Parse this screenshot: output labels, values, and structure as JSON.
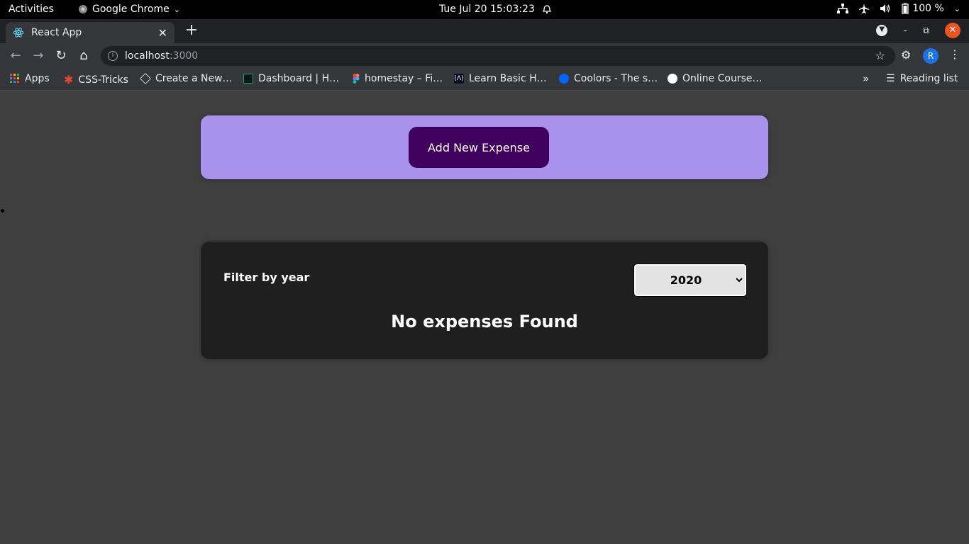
{
  "system": {
    "activities": "Activities",
    "app_name": "Google Chrome",
    "clock": "Tue Jul 20  15:03:23",
    "battery": "100 %"
  },
  "browser": {
    "tab_title": "React App",
    "url_host": "localhost",
    "url_port": ":3000",
    "profile_initial": "R",
    "bookmarks": [
      {
        "label": "Apps",
        "icon": "apps-grid-icon",
        "color": "#ea4335"
      },
      {
        "label": "CSS-Tricks",
        "icon": "css-tricks-icon",
        "color": "#e8472c"
      },
      {
        "label": "Create a New…",
        "icon": "codepen-icon",
        "color": "#ffffff"
      },
      {
        "label": "Dashboard | H…",
        "icon": "hackerrank-icon",
        "color": "#1ba94c"
      },
      {
        "label": "homestay – Fi…",
        "icon": "figma-icon",
        "color": "#f24e1e"
      },
      {
        "label": "Learn Basic H…",
        "icon": "freecodecamp-icon",
        "color": "#0a0a23"
      },
      {
        "label": "Coolors - The s…",
        "icon": "coolors-icon",
        "color": "#0066ff"
      },
      {
        "label": "Online Course…",
        "icon": "udemy-icon",
        "color": "#ffffff"
      }
    ],
    "reading_list": "Reading list"
  },
  "app": {
    "add_button": "Add New Expense",
    "filter_label": "Filter by year",
    "selected_year": "2020",
    "empty_message": "No expenses Found"
  },
  "colors": {
    "new_expense_bg": "#a892ee",
    "button_bg": "#40005d",
    "expenses_bg": "#1f1f1f",
    "page_bg": "#3f3f3f"
  }
}
